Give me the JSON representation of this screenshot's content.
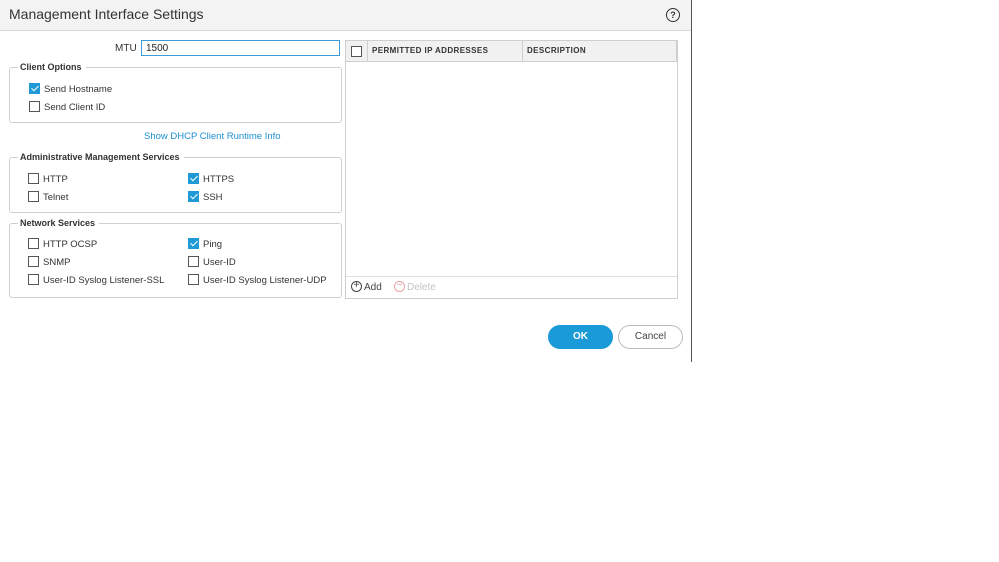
{
  "dialog": {
    "title": "Management Interface Settings",
    "help_icon": "question-circle-icon"
  },
  "mtu": {
    "label": "MTU",
    "value": "1500"
  },
  "client_options": {
    "legend": "Client Options",
    "items": [
      {
        "label": "Send Hostname",
        "checked": true
      },
      {
        "label": "Send Client ID",
        "checked": false
      }
    ]
  },
  "dhcp_link": "Show DHCP Client Runtime Info",
  "admin_services": {
    "legend": "Administrative Management Services",
    "items": [
      {
        "label": "HTTP",
        "checked": false
      },
      {
        "label": "Telnet",
        "checked": false
      },
      {
        "label": "HTTPS",
        "checked": true
      },
      {
        "label": "SSH",
        "checked": true
      }
    ]
  },
  "network_services": {
    "legend": "Network Services",
    "items": [
      {
        "label": "HTTP OCSP",
        "checked": false
      },
      {
        "label": "SNMP",
        "checked": false
      },
      {
        "label": "User-ID Syslog Listener-SSL",
        "checked": false
      },
      {
        "label": "Ping",
        "checked": true
      },
      {
        "label": "User-ID",
        "checked": false
      },
      {
        "label": "User-ID Syslog Listener-UDP",
        "checked": false
      }
    ]
  },
  "ip_table": {
    "select_all_checked": false,
    "columns": [
      "PERMITTED IP ADDRESSES",
      "DESCRIPTION"
    ],
    "rows": [],
    "add_label": "Add",
    "delete_label": "Delete"
  },
  "buttons": {
    "ok": "OK",
    "cancel": "Cancel"
  },
  "colors": {
    "accent": "#1a9ad7",
    "link": "#1e8fd1"
  }
}
